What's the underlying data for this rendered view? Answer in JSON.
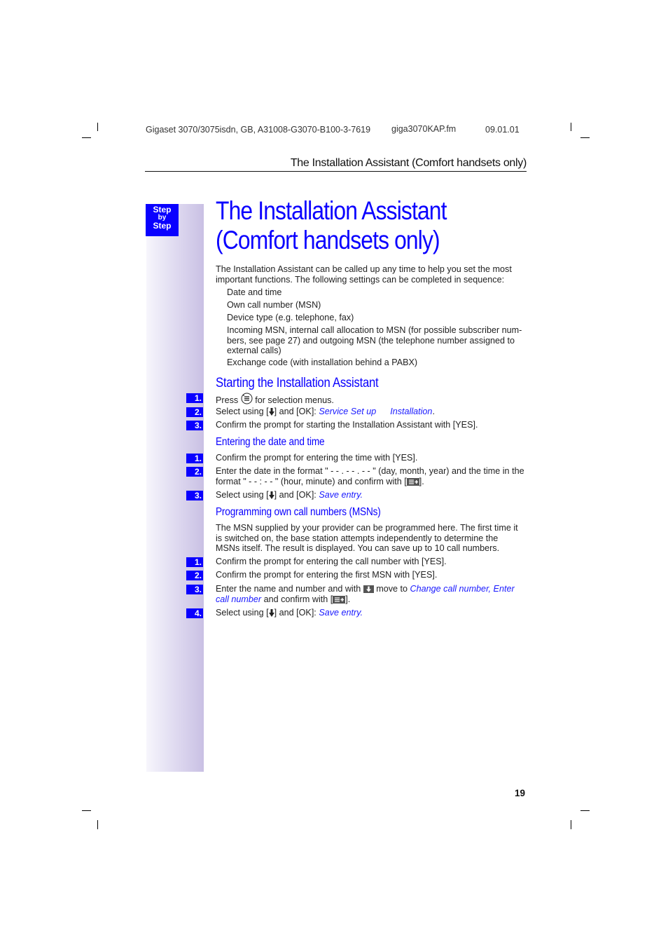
{
  "header": {
    "doc_id": "Gigaset 3070/3075isdn, GB, A31008-G3070-B100-3-7619",
    "file": "giga3070KAP.fm",
    "date": "09.01.01",
    "running_head": "The Installation Assistant (Comfort handsets only)"
  },
  "sidebar": {
    "badge": {
      "line1": "Step",
      "line2": "by",
      "line3": "Step"
    }
  },
  "title": {
    "line1": "The Installation Assistant",
    "line2": "(Comfort handsets only)"
  },
  "intro": {
    "line1": "The Installation Assistant can be called up any time to help you set the most",
    "line2": "important functions. The following settings can be completed in sequence:",
    "items": [
      "Date and time",
      "Own call number (MSN)",
      "Device type (e.g. telephone, fax)",
      "Incoming MSN, internal call allocation to MSN (for possible subscriber num-",
      "bers, see page 27) and outgoing MSN (the telephone number assigned to",
      "external calls)",
      "Exchange code (with installation behind a PABX)"
    ]
  },
  "sections": {
    "starting": {
      "heading": "Starting the Installation Assistant",
      "steps": [
        {
          "num": "1.",
          "pre": "Press",
          "post": "for selection menus.",
          "icon": "menu-key-icon"
        },
        {
          "num": "2.",
          "pre": "Select using [",
          "mid": "] and [OK]: ",
          "menu1": "Service Set up",
          "menu2": "Installation",
          "post": ".",
          "icon": "down-arrow-icon"
        },
        {
          "num": "3.",
          "text": "Confirm the prompt for starting the Installation Assistant with [YES]."
        }
      ]
    },
    "date_time": {
      "heading": "Entering the date and time",
      "steps": [
        {
          "num": "1.",
          "text": "Confirm the prompt for entering the time with [YES]."
        },
        {
          "num": "2.",
          "line1": "Enter the date in the format \" - - . - - . - - \" (day, month, year) and the time in the",
          "line2_pre": "format \" - - : - - \" (hour, minute) and confirm with [",
          "line2_post": "].",
          "icon": "confirm-key-icon"
        },
        {
          "num": "3.",
          "pre": "Select using [",
          "mid": "] and [OK]: ",
          "menu": "Save entry",
          "post": ".",
          "icon": "down-arrow-icon"
        }
      ]
    },
    "msn": {
      "heading": "Programming own call numbers (MSNs)",
      "intro": [
        "The MSN supplied by your provider can be programmed here. The first time it",
        "is switched on, the base station attempts independently to determine the",
        "MSNs itself. The result is displayed. You can save up to 10 call numbers."
      ],
      "steps": [
        {
          "num": "1.",
          "text": "Confirm the prompt for entering the call number with [YES]."
        },
        {
          "num": "2.",
          "text": "Confirm the prompt for entering the first MSN with [YES]."
        },
        {
          "num": "3.",
          "pre": "Enter the name and number and with",
          "mid": "move to",
          "menu1": "Change call number, Enter",
          "menu2": "call number",
          "post_pre": "and confirm with [",
          "post_post": "]."
        },
        {
          "num": "4.",
          "pre": "Select using [",
          "mid": "] and [OK]: ",
          "menu": "Save entry",
          "post": "."
        }
      ]
    }
  },
  "footer": {
    "page_number": "19"
  },
  "colors": {
    "accent": "#0a00ff",
    "menu_text": "#1a1aff",
    "sidebar_gradient_end": "#c9c0e4"
  }
}
